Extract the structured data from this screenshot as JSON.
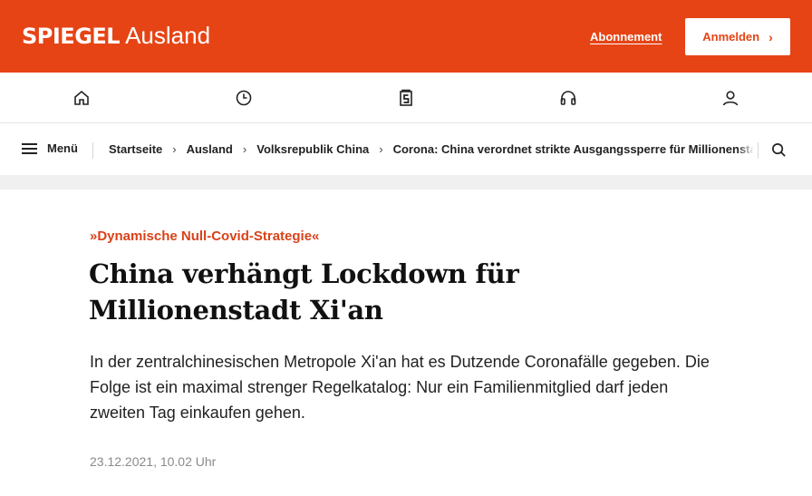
{
  "header": {
    "logo": "SPIEGEL",
    "section": "Ausland",
    "subscription_link": "Abonnement",
    "login_button": "Anmelden",
    "login_chevron": "›",
    "brand_color": "#e64415"
  },
  "icon_nav": [
    {
      "name": "home-icon"
    },
    {
      "name": "clock-icon"
    },
    {
      "name": "spiegel-plus-icon"
    },
    {
      "name": "headphones-icon"
    },
    {
      "name": "user-icon"
    }
  ],
  "breadcrumb": {
    "menu_label": "Menü",
    "items": [
      "Startseite",
      "Ausland",
      "Volksrepublik China",
      "Corona: China verordnet strikte Ausgangssperre für Millionenstadt Xi'an"
    ],
    "separator": "›"
  },
  "article": {
    "kicker": "»Dynamische Null-Covid-Strategie«",
    "headline": "China verhängt Lockdown für Millionenstadt Xi'an",
    "lead": "In der zentralchinesischen Metropole Xi'an hat es Dutzende Coronafälle gegeben. Die Folge ist ein maximal strenger Regelkatalog: Nur ein Familienmitglied darf jeden zweiten Tag einkaufen gehen.",
    "date": "23.12.2021, 10.02 Uhr",
    "kicker_color": "#d9421a"
  }
}
